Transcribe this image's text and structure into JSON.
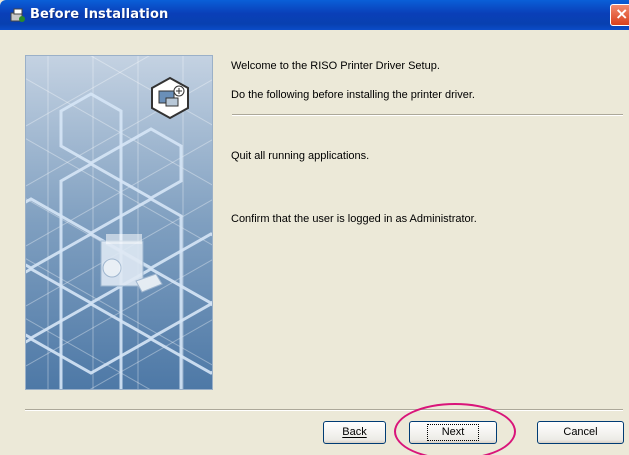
{
  "window": {
    "title": "Before Installation"
  },
  "messages": {
    "welcome": "Welcome to the RISO Printer Driver Setup.",
    "instruction": "Do the following before installing the printer driver.",
    "step1": "Quit all running applications.",
    "step2": "Confirm that the user is logged in as Administrator."
  },
  "buttons": {
    "back": "Back",
    "next": "Next",
    "cancel": "Cancel"
  },
  "colors": {
    "titlebar": "#0a3fb8",
    "highlight_ring": "#d9157a",
    "dialog_bg": "#ece9d8"
  }
}
